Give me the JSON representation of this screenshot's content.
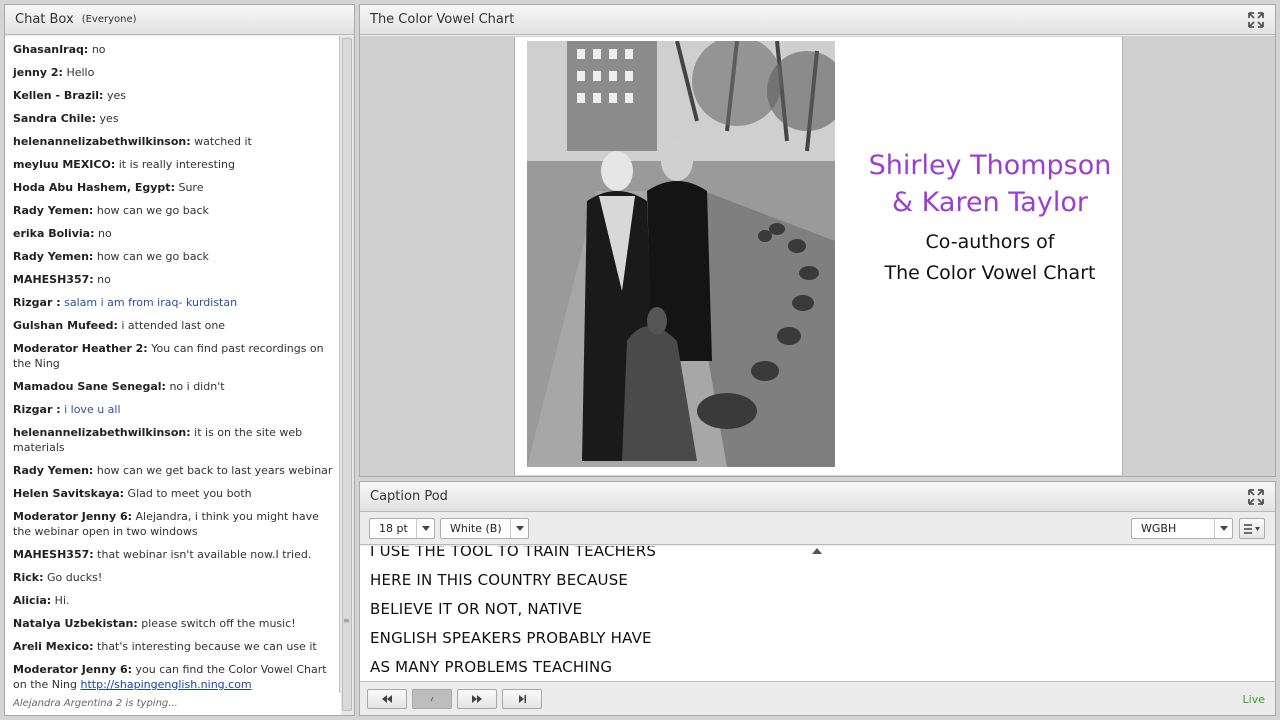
{
  "chat": {
    "title": "Chat Box",
    "audience": "(Everyone)",
    "messages": [
      {
        "who": "GhasanIraq:",
        "text": "no"
      },
      {
        "who": "jenny 2:",
        "text": "Hello"
      },
      {
        "who": "Kellen - Brazil:",
        "text": "yes"
      },
      {
        "who": "Sandra Chile:",
        "text": "yes"
      },
      {
        "who": "helenannelizabethwilkinson:",
        "text": "watched it"
      },
      {
        "who": "meyluu MEXICO:",
        "text": "it is really interesting"
      },
      {
        "who": "Hoda Abu Hashem, Egypt:",
        "text": "Sure"
      },
      {
        "who": "Rady Yemen:",
        "text": "how can we go back"
      },
      {
        "who": "erika Bolivia:",
        "text": "no"
      },
      {
        "who": "Rady Yemen:",
        "text": "how can we go back"
      },
      {
        "who": "MAHESH357:",
        "text": "no"
      },
      {
        "who": "Rizgar :",
        "text": "salam i am from iraq- kurdistan",
        "blue": true
      },
      {
        "who": "Gulshan Mufeed:",
        "text": "i attended last one"
      },
      {
        "who": "Moderator Heather 2:",
        "text": "You can find past recordings on the Ning"
      },
      {
        "who": "Mamadou Sane Senegal:",
        "text": "no i didn't"
      },
      {
        "who": "Rizgar :",
        "text": "i love u all",
        "blue": true
      },
      {
        "who": "helenannelizabethwilkinson:",
        "text": "it is on the site web materials"
      },
      {
        "who": "Rady Yemen:",
        "text": "how can we get back to last years webinar"
      },
      {
        "who": "Helen Savitskaya:",
        "text": "Glad to meet you both"
      },
      {
        "who": "Moderator Jenny 6:",
        "text": "Alejandra, i think you might have the webinar open in two windows"
      },
      {
        "who": "MAHESH357:",
        "text": "that webinar isn't available now.I tried."
      },
      {
        "who": "Rick:",
        "text": "Go ducks!"
      },
      {
        "who": "Alicia:",
        "text": "Hi."
      },
      {
        "who": "Natalya Uzbekistan:",
        "text": "please switch off the music!"
      },
      {
        "who": "Areli Mexico:",
        "text": "that's interesting because we can use it"
      },
      {
        "who": "Moderator Jenny 6:",
        "text": "you can find the Color Vowel Chart on the Ning",
        "link": "http://shapingenglish.ning.com"
      }
    ],
    "typing": "Alejandra Argentina 2 is typing..."
  },
  "share": {
    "title": "The Color Vowel Chart",
    "slide": {
      "title_line1": "Shirley Thompson",
      "title_line2": "& Karen Taylor",
      "sub_line1": "Co-authors of",
      "sub_line2": "The Color Vowel Chart"
    }
  },
  "caption": {
    "title": "Caption Pod",
    "font_size": "18 pt",
    "color_option": "White (B)",
    "source": "WGBH",
    "lines": [
      "I USE THE TOOL TO TRAIN TEACHERS",
      "HERE IN THIS COUNTRY BECAUSE",
      "BELIEVE IT OR NOT, NATIVE",
      "ENGLISH SPEAKERS PROBABLY HAVE",
      "AS MANY PROBLEMS TEACHING"
    ],
    "status": "Live"
  },
  "colors": {
    "accent_purple": "#9b3fd0",
    "live_green": "#3e9b2f",
    "link_blue": "#1c3fa8"
  }
}
